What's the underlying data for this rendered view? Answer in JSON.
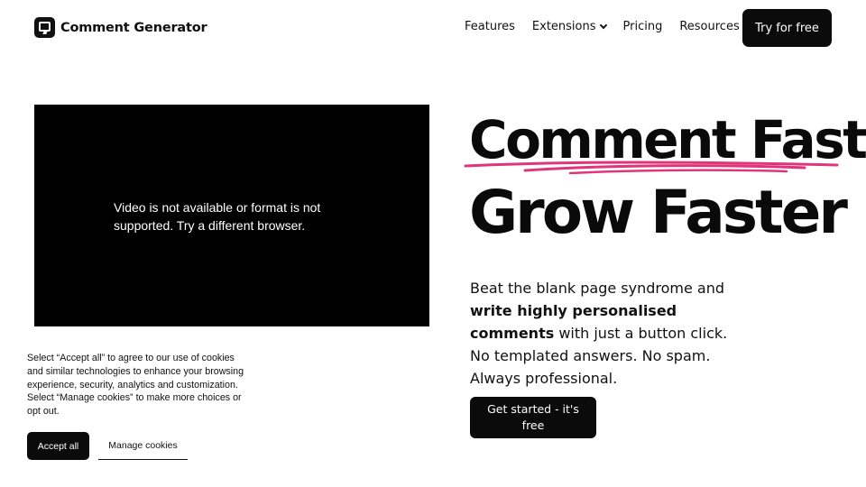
{
  "header": {
    "brand": "Comment Generator",
    "nav": [
      {
        "label": "Features",
        "dropdown": false
      },
      {
        "label": "Extensions",
        "dropdown": true
      },
      {
        "label": "Pricing",
        "dropdown": false
      },
      {
        "label": "Resources",
        "dropdown": true
      }
    ],
    "cta_label": "Try for free"
  },
  "video": {
    "message": "Video is not available or format is not supported. Try a different browser."
  },
  "hero": {
    "headline_1": "Comment Fast",
    "headline_2": "Grow Faster",
    "underline_color": "#e0357a",
    "description_pre": "Beat the blank page syndrome and ",
    "description_bold": "write highly personalised comments",
    "description_post": " with just a button click. No templated answers. No spam. Always professional.",
    "cta_label": "Get started - it's free"
  },
  "cookie_banner": {
    "text": "Select “Accept all” to agree to our use of cookies and similar technologies to enhance your browsing experience, security, analytics and customization. Select “Manage cookies” to make more choices or opt out.",
    "accept_label": "Accept all",
    "manage_label": "Manage cookies"
  },
  "icons": {
    "logo": "comment-generator-logo-icon",
    "dropdown": "chevron-down-icon"
  }
}
